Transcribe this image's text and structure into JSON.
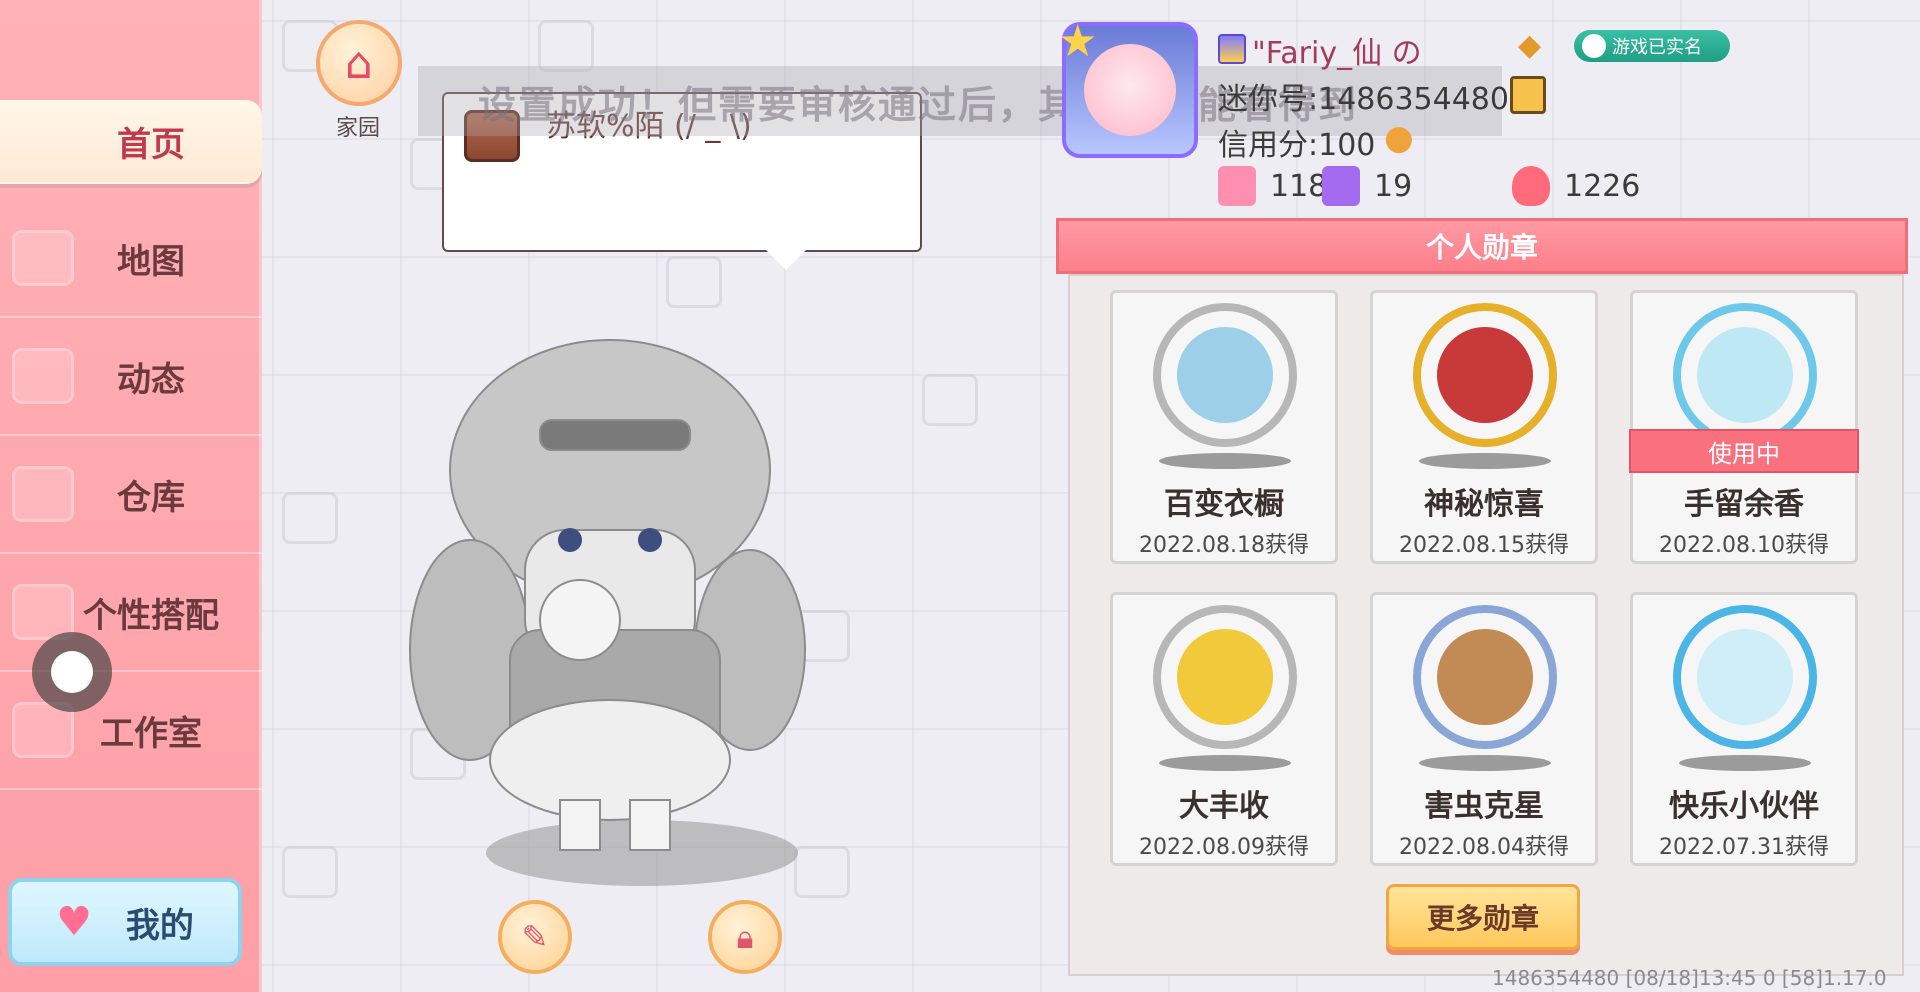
{
  "sidebar": {
    "items": [
      {
        "label": "首页"
      },
      {
        "label": "地图"
      },
      {
        "label": "动态"
      },
      {
        "label": "仓库"
      },
      {
        "label": "个性搭配"
      },
      {
        "label": "工作室"
      }
    ],
    "mine_label": "我的"
  },
  "home": {
    "label": "家园"
  },
  "toast": {
    "text": "设置成功！但需要审核通过后，其他人才能看得到"
  },
  "bubble": {
    "text": "苏软%陌 (/ _ \\)"
  },
  "profile": {
    "name": "\"Fariy_仙  の",
    "realname_badge": "游戏已实名",
    "mini_id": "迷你号:1486354480",
    "credit": "信用分:100",
    "stats": [
      {
        "icon": "plus-ribbon-icon",
        "value": "118"
      },
      {
        "icon": "trophy-person-icon",
        "value": "19"
      },
      {
        "icon": "flame-icon",
        "value": "1226"
      }
    ]
  },
  "medals": {
    "title": "个人勋章",
    "in_use_label": "使用中",
    "items": [
      {
        "name": "百变衣橱",
        "date": "2022.08.18获得",
        "icon": "wardrobe-medal-icon",
        "rim": "#b7b7b7",
        "center": "#9ecfe9"
      },
      {
        "name": "神秘惊喜",
        "date": "2022.08.15获得",
        "icon": "gift-medal-icon",
        "rim": "#e6b02a",
        "center": "#c83a3a"
      },
      {
        "name": "手留余香",
        "date": "2022.08.10获得",
        "icon": "flower-medal-icon",
        "rim": "#6ec8ea",
        "center": "#bfe8f5",
        "in_use": true
      },
      {
        "name": "大丰收",
        "date": "2022.08.09获得",
        "icon": "harvest-medal-icon",
        "rim": "#b7b7b7",
        "center": "#f3c93c"
      },
      {
        "name": "害虫克星",
        "date": "2022.08.04获得",
        "icon": "bug-medal-icon",
        "rim": "#8aa6d6",
        "center": "#c28a54"
      },
      {
        "name": "快乐小伙伴",
        "date": "2022.07.31获得",
        "icon": "friends-medal-icon",
        "rim": "#4bb6e6",
        "center": "#cfeef8"
      }
    ],
    "more_label": "更多勋章"
  },
  "footer": {
    "text": "1486354480   [08/18]13:45 0  [58]1.17.0"
  },
  "colors": {
    "sidebar": "#fd9fa7",
    "accent": "#fb7f8b",
    "in_use": "#f9707e"
  }
}
